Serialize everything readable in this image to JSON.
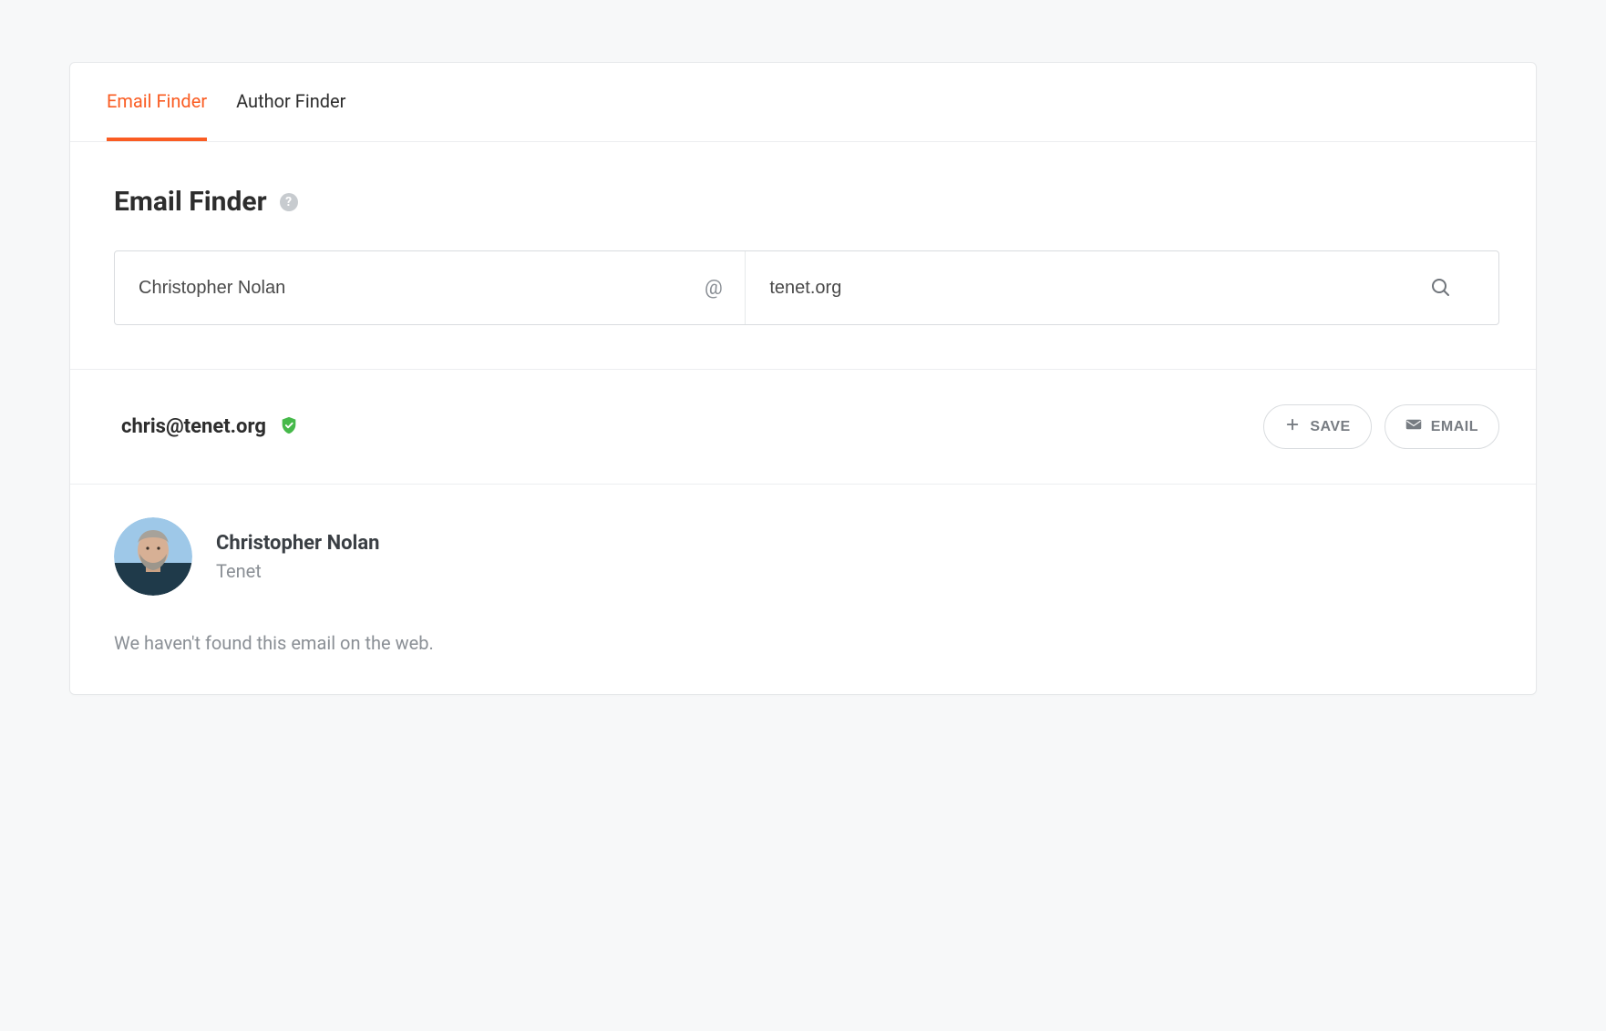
{
  "tabs": {
    "email_finder": "Email Finder",
    "author_finder": "Author Finder"
  },
  "heading": "Email Finder",
  "form": {
    "name_value": "Christopher Nolan",
    "at_symbol": "@",
    "domain_value": "tenet.org"
  },
  "result": {
    "email": "chris@tenet.org",
    "actions": {
      "save": "SAVE",
      "email": "EMAIL"
    }
  },
  "person": {
    "name": "Christopher Nolan",
    "company": "Tenet",
    "note": "We haven't found this email on the web."
  }
}
